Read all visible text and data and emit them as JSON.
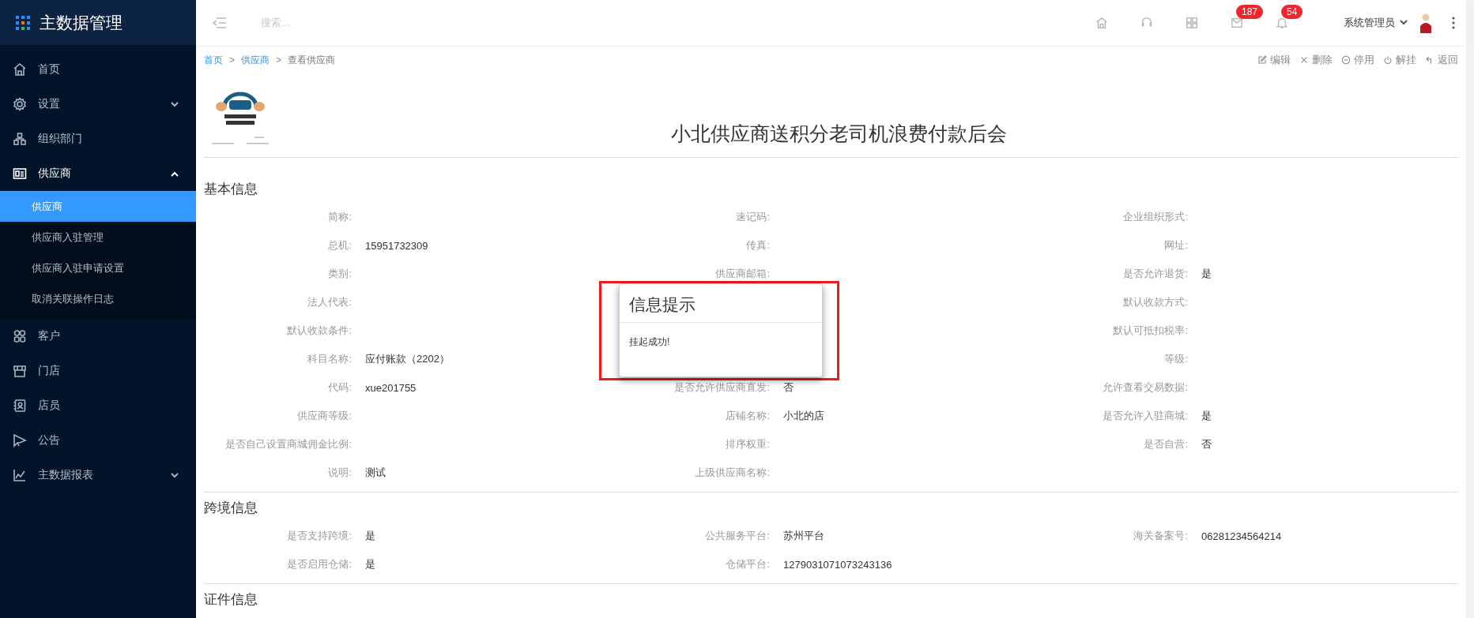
{
  "app": {
    "title": "主数据管理"
  },
  "sidebar": {
    "items": [
      {
        "label": "首页",
        "kind": "link",
        "expanded": false
      },
      {
        "label": "设置",
        "kind": "group",
        "expanded": false
      },
      {
        "label": "组织部门",
        "kind": "link",
        "expanded": false
      },
      {
        "label": "供应商",
        "kind": "group",
        "expanded": true,
        "children": [
          {
            "label": "供应商",
            "selected": true
          },
          {
            "label": "供应商入驻管理",
            "selected": false
          },
          {
            "label": "供应商入驻申请设置",
            "selected": false
          },
          {
            "label": "取消关联操作日志",
            "selected": false
          }
        ]
      },
      {
        "label": "客户",
        "kind": "link",
        "expanded": false
      },
      {
        "label": "门店",
        "kind": "link",
        "expanded": false
      },
      {
        "label": "店员",
        "kind": "link",
        "expanded": false
      },
      {
        "label": "公告",
        "kind": "link",
        "expanded": false
      },
      {
        "label": "主数据报表",
        "kind": "group",
        "expanded": false
      }
    ]
  },
  "header": {
    "search": {
      "placeholder": "搜索..."
    },
    "badges": [
      "187",
      "54"
    ],
    "user": "系统管理员"
  },
  "breadcrumb": [
    {
      "label": "首页",
      "kind": "link"
    },
    {
      "label": ">",
      "kind": "separator"
    },
    {
      "label": "供应商",
      "kind": "link"
    },
    {
      "label": ">",
      "kind": "separator"
    },
    {
      "label": "查看供应商",
      "kind": "current"
    }
  ],
  "actions": [
    "编辑",
    "删除",
    "停用",
    "解挂",
    "返回"
  ],
  "supplier": {
    "name": "小北供应商送积分老司机浪费付款后会"
  },
  "sections": [
    {
      "title": "基本信息",
      "rows": [
        [
          {
            "label": "简称:"
          },
          {
            "label": "速记码:"
          },
          {
            "label": "企业组织形式:"
          }
        ],
        [
          {
            "label": "总机:",
            "value": "15951732309"
          },
          {
            "label": "传真:"
          },
          {
            "label": "网址:"
          }
        ],
        [
          {
            "label": "类别:"
          },
          {
            "label": "供应商邮箱:"
          },
          {
            "label": "是否允许退货:",
            "value": "是"
          }
        ],
        [
          {
            "label": "法人代表:"
          },
          {},
          {
            "label": "默认收款方式:"
          }
        ],
        [
          {
            "label": "默认收款条件:"
          },
          {},
          {
            "label": "默认可抵扣税率:"
          }
        ],
        [
          {
            "label": "科目名称:",
            "value": "应付账款（2202）"
          },
          {},
          {
            "label": "等级:"
          }
        ],
        [
          {
            "label": "代码:",
            "value": "xue201755"
          },
          {
            "label": "是否允许供应商直发:",
            "value": "否"
          },
          {
            "label": "允许查看交易数据:"
          }
        ],
        [
          {
            "label": "供应商等级:"
          },
          {
            "label": "店铺名称:",
            "value": "小北的店"
          },
          {
            "label": "是否允许入驻商城:",
            "value": "是"
          }
        ],
        [
          {
            "label": "是否自己设置商城佣金比例:"
          },
          {
            "label": "排序权重:"
          },
          {
            "label": "是否自营:",
            "value": "否"
          }
        ],
        [
          {
            "label": "说明:",
            "value": "测试"
          },
          {
            "label": "上级供应商名称:"
          },
          {}
        ]
      ]
    },
    {
      "title": "跨境信息",
      "rows": [
        [
          {
            "label": "是否支持跨境:",
            "value": "是"
          },
          {
            "label": "公共服务平台:",
            "value": "苏州平台"
          },
          {
            "label": "海关备案号:",
            "value": "06281234564214"
          }
        ],
        [
          {
            "label": "是否启用仓储:",
            "value": "是"
          },
          {
            "label": "仓储平台:",
            "value": "1279031071073243136"
          },
          {}
        ]
      ]
    },
    {
      "title": "证件信息"
    }
  ],
  "dialog": {
    "title": "信息提示",
    "message": "挂起成功!",
    "highlighted": true
  }
}
